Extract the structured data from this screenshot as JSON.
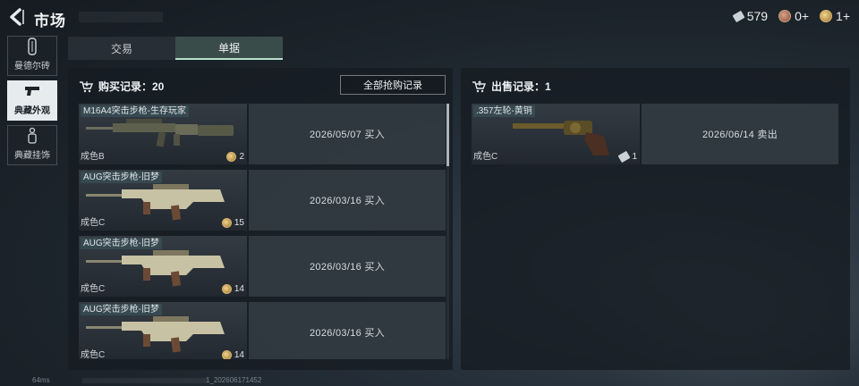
{
  "header": {
    "title": "市场",
    "currencies": [
      {
        "icon": "ticket-icon",
        "value": "579"
      },
      {
        "icon": "red-coin-icon",
        "value": "0+"
      },
      {
        "icon": "gold-coin-icon",
        "value": "1+"
      }
    ]
  },
  "side_nav": [
    {
      "label": "曼德尔砖",
      "icon": "mandel-brick-icon",
      "active": false
    },
    {
      "label": "典藏外观",
      "icon": "pistol-icon",
      "active": true
    },
    {
      "label": "典藏挂饰",
      "icon": "charm-icon",
      "active": false
    }
  ],
  "tabs": [
    {
      "label": "交易",
      "active": false
    },
    {
      "label": "单据",
      "active": true
    }
  ],
  "purchase": {
    "header": "购买记录：20",
    "all_button": "全部抢购记录",
    "rows": [
      {
        "name": "M16A4突击步枪-生存玩家",
        "grade": "成色B",
        "qty": "2",
        "date_action": "2026/05/07 买入"
      },
      {
        "name": "AUG突击步枪-旧梦",
        "grade": "成色C",
        "qty": "15",
        "date_action": "2026/03/16 买入"
      },
      {
        "name": "AUG突击步枪-旧梦",
        "grade": "成色C",
        "qty": "14",
        "date_action": "2026/03/16 买入"
      },
      {
        "name": "AUG突击步枪-旧梦",
        "grade": "成色C",
        "qty": "14",
        "date_action": "2026/03/16 买入"
      }
    ]
  },
  "sale": {
    "header": "出售记录：1",
    "rows": [
      {
        "name": ".357左轮-黄铜",
        "grade": "成色C",
        "qty": "1",
        "date_action": "2026/06/14 卖出"
      }
    ]
  },
  "footer": {
    "ping": "64ms",
    "uid": "1_202606171452"
  }
}
